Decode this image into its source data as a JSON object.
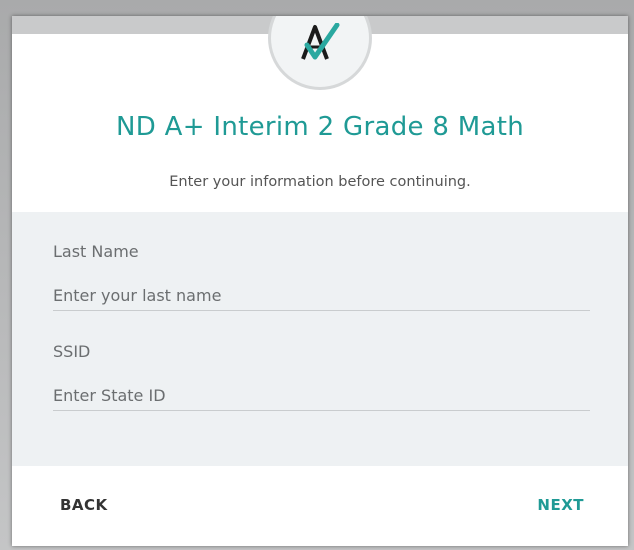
{
  "colors": {
    "accent": "#1f9a95",
    "form_background": "#eef1f3",
    "card_background": "#ffffff"
  },
  "logo": {
    "icon": "a-plus-check-logo-icon"
  },
  "header": {
    "title": "ND A+ Interim 2 Grade 8 Math",
    "subtitle": "Enter your information before continuing."
  },
  "form": {
    "last_name": {
      "label": "Last Name",
      "placeholder": "Enter your last name",
      "value": ""
    },
    "ssid": {
      "label": "SSID",
      "placeholder": "Enter State ID",
      "value": ""
    }
  },
  "footer": {
    "back_label": "BACK",
    "next_label": "NEXT"
  }
}
